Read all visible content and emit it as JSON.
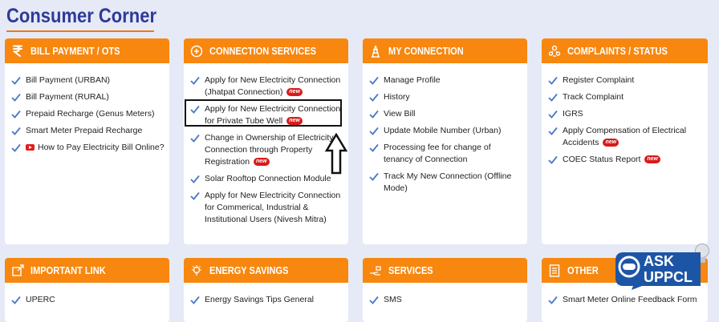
{
  "page": {
    "title": "Consumer Corner"
  },
  "colors": {
    "accent": "#f7870f",
    "title": "#2d3a97",
    "background": "#e6eaf6",
    "check": "#4a78c9",
    "new_badge": "#d91a1a"
  },
  "badge": {
    "new": "new"
  },
  "cards": [
    {
      "title": "BILL PAYMENT / OTS",
      "icon": "rupee-icon",
      "items": [
        {
          "label": "Bill Payment (URBAN)"
        },
        {
          "label": "Bill Payment (RURAL)"
        },
        {
          "label": "Prepaid Recharge (Genus Meters)"
        },
        {
          "label": "Smart Meter Prepaid Recharge"
        },
        {
          "label": "How to Pay Electricity Bill Online?",
          "icon": "youtube-icon"
        }
      ]
    },
    {
      "title": "CONNECTION SERVICES",
      "icon": "plug-icon",
      "items": [
        {
          "label": "Apply for New Electricity Connection (Jhatpat Connection)",
          "new": true
        },
        {
          "label": "Apply for New Electricity Connection for Private Tube Well",
          "new": true,
          "highlighted": true
        },
        {
          "label": "Change in Ownership of Electricity Connection through Property Registration",
          "new": true
        },
        {
          "label": "Solar Rooftop Connection Module"
        },
        {
          "label": "Apply for New Electricity Connection for Commerical, Industrial & Institutional Users (Nivesh Mitra)"
        }
      ]
    },
    {
      "title": "MY CONNECTION",
      "icon": "tower-icon",
      "items": [
        {
          "label": "Manage Profile"
        },
        {
          "label": "History"
        },
        {
          "label": "View Bill"
        },
        {
          "label": "Update Mobile Number (Urban)"
        },
        {
          "label": "Processing fee for change of tenancy of Connection"
        },
        {
          "label": "Track My New Connection (Offline Mode)"
        }
      ]
    },
    {
      "title": "COMPLAINTS / STATUS",
      "icon": "people-icon",
      "items": [
        {
          "label": "Register Complaint"
        },
        {
          "label": "Track Complaint"
        },
        {
          "label": "IGRS"
        },
        {
          "label": "Apply Compensation of Electrical Accidents",
          "new": true
        },
        {
          "label": "COEC Status Report",
          "new": true
        }
      ]
    },
    {
      "title": "IMPORTANT LINK",
      "icon": "link-icon",
      "items": [
        {
          "label": "UPERC"
        }
      ]
    },
    {
      "title": "ENERGY SAVINGS",
      "icon": "bulb-icon",
      "items": [
        {
          "label": "Energy Savings Tips General"
        }
      ]
    },
    {
      "title": "SERVICES",
      "icon": "hand-icon",
      "items": [
        {
          "label": "SMS"
        }
      ]
    },
    {
      "title": "OTHER",
      "icon": "document-icon",
      "items": [
        {
          "label": "Smart Meter Online Feedback Form"
        }
      ]
    }
  ],
  "chatbot": {
    "line1": "ASK",
    "line2": "UPPCL"
  }
}
